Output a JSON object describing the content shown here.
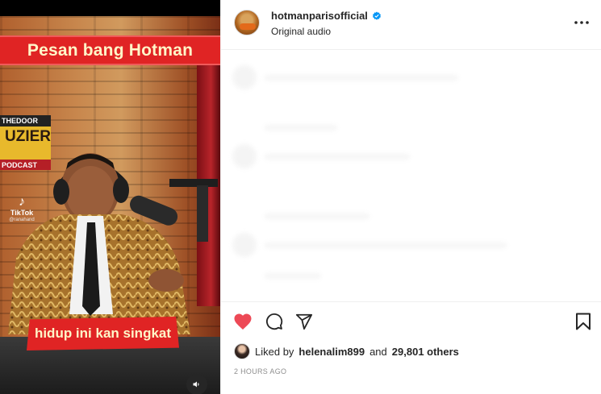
{
  "video": {
    "caption_top": "Pesan bang Hotman",
    "caption_bottom": "hidup ini kan singkat",
    "podcast_sign": {
      "line1": "THEDOOR",
      "line2": "UZIER",
      "line3": "PODCAST"
    },
    "tiktok": {
      "label": "TikTok",
      "handle": "@ranahand"
    },
    "volume_icon": "speaker-icon"
  },
  "post": {
    "username": "hotmanparisofficial",
    "verified": true,
    "audio": "Original audio",
    "more_icon": "more-horizontal-icon",
    "actions": {
      "like_icon": "heart-filled-icon",
      "comment_icon": "comment-icon",
      "share_icon": "send-icon",
      "save_icon": "bookmark-icon"
    },
    "likes": {
      "prefix": "Liked by",
      "user": "helenalim899",
      "conjunction": "and",
      "others": "29,801 others"
    },
    "timestamp": "2 HOURS AGO",
    "colors": {
      "like": "#ed4956",
      "verified": "#0095f6",
      "caption_red": "#e02424"
    }
  }
}
